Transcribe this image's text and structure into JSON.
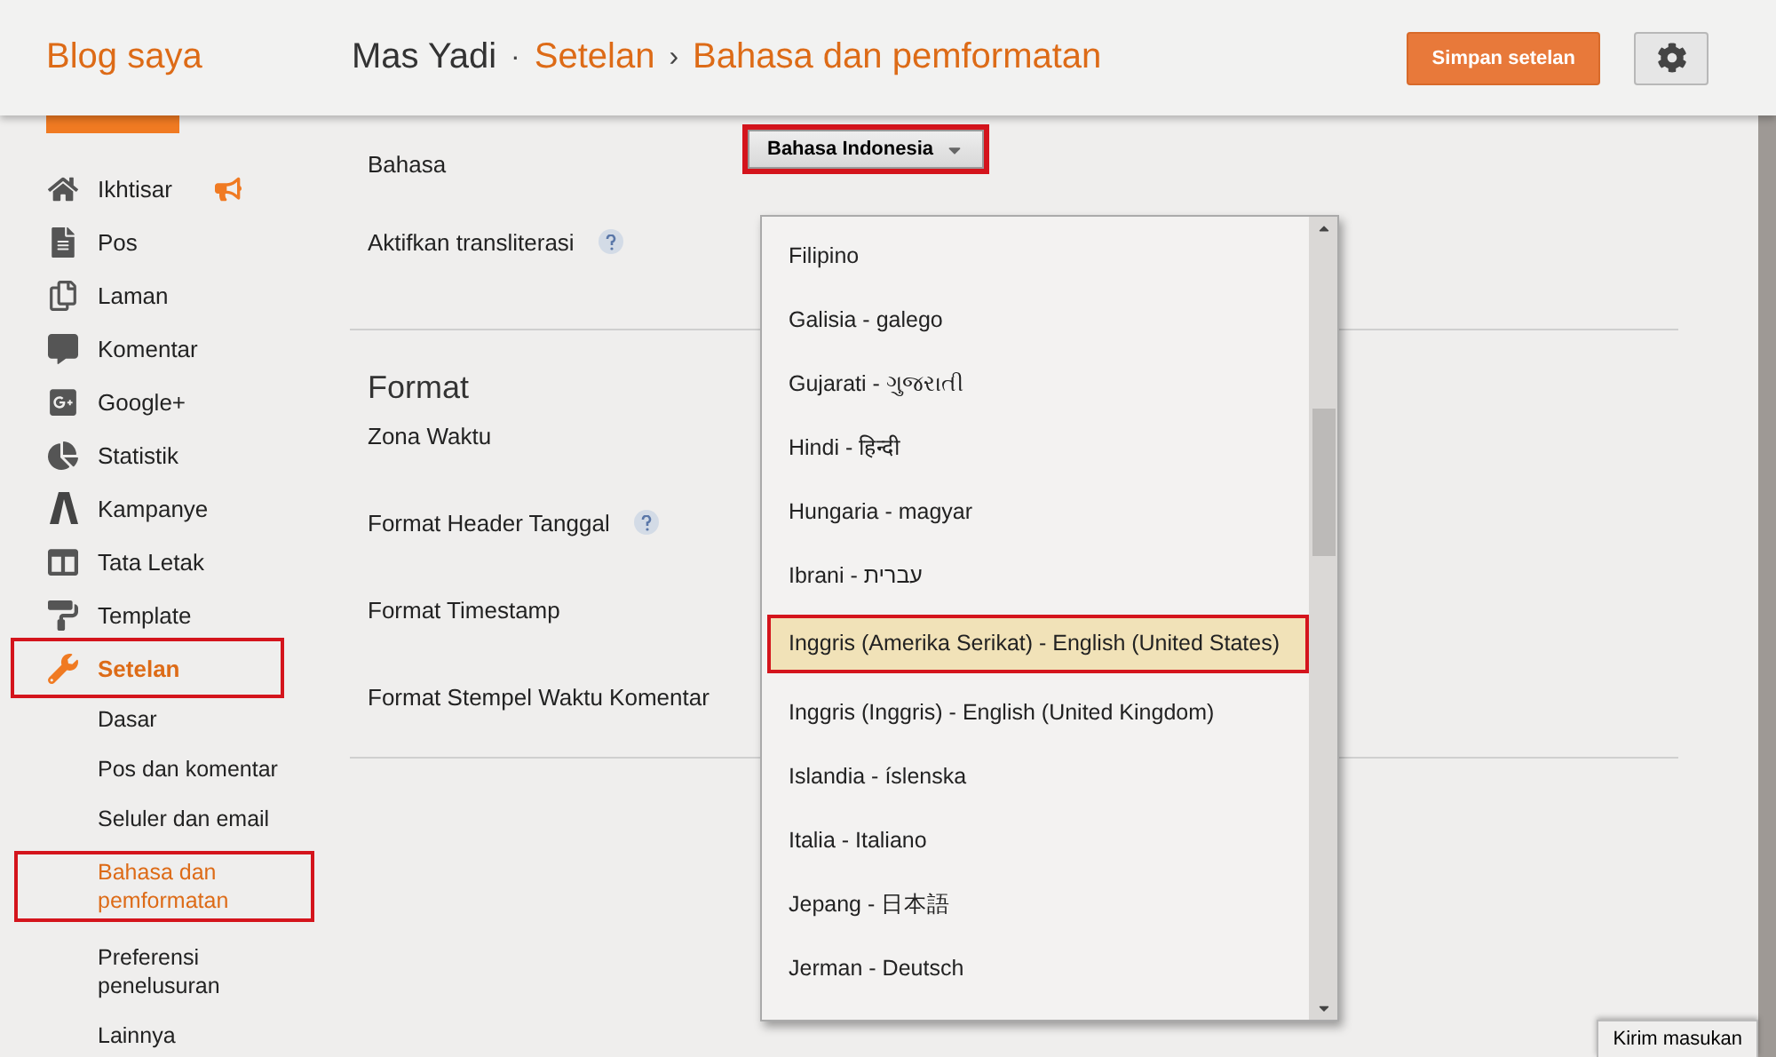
{
  "header": {
    "brand": "Blog saya",
    "breadcrumb": [
      {
        "label": "Mas Yadi",
        "kind": "blog",
        "separator": "·"
      },
      {
        "label": "Setelan",
        "kind": "link",
        "separator": "›"
      },
      {
        "label": "Bahasa dan pemformatan",
        "kind": "link"
      }
    ],
    "save_button": "Simpan setelan"
  },
  "sidebar": {
    "items": [
      {
        "label": "Ikhtisar",
        "selected": false,
        "badge": true
      },
      {
        "label": "Pos",
        "selected": false
      },
      {
        "label": "Laman",
        "selected": false
      },
      {
        "label": "Komentar",
        "selected": false
      },
      {
        "label": "Google+",
        "selected": false
      },
      {
        "label": "Statistik",
        "selected": false
      },
      {
        "label": "Kampanye",
        "selected": false
      },
      {
        "label": "Tata Letak",
        "selected": false
      },
      {
        "label": "Template",
        "selected": false
      },
      {
        "label": "Setelan",
        "selected": true,
        "outlined": true,
        "children": [
          {
            "label": "Dasar",
            "selected": false,
            "outlined": false
          },
          {
            "label": "Pos dan komentar",
            "selected": false,
            "outlined": false
          },
          {
            "label": "Seluler dan email",
            "selected": false,
            "outlined": false
          },
          {
            "label": "Bahasa dan pemformatan",
            "selected": true,
            "outlined": true
          },
          {
            "label": "Preferensi penelusuran",
            "selected": false,
            "outlined": false
          },
          {
            "label": "Lainnya",
            "selected": false,
            "outlined": false
          }
        ]
      }
    ]
  },
  "language_section": {
    "rows": [
      {
        "label": "Bahasa",
        "kind": "select",
        "value": "Bahasa Indonesia",
        "outlined": true
      },
      {
        "label": "Aktifkan transliterasi",
        "kind": "help"
      }
    ]
  },
  "format_section": {
    "title": "Format",
    "rows": [
      {
        "label": "Zona Waktu",
        "kind": "plain"
      },
      {
        "label": "Format Header Tanggal",
        "kind": "help"
      },
      {
        "label": "Format Timestamp",
        "kind": "plain"
      },
      {
        "label": "Format Stempel Waktu Komentar",
        "kind": "plain"
      }
    ]
  },
  "language_dropdown": {
    "options": [
      {
        "label": "Filipino",
        "selected": false
      },
      {
        "label": "Galisia - galego",
        "selected": false
      },
      {
        "label": "Gujarati - ગુજરાતી",
        "selected": false
      },
      {
        "label": "Hindi - हिन्दी",
        "selected": false
      },
      {
        "label": "Hungaria - magyar",
        "selected": false
      },
      {
        "label": "Ibrani - עברית",
        "selected": false
      },
      {
        "label": "Inggris (Amerika Serikat) - English (United States)",
        "selected": true,
        "outlined": true
      },
      {
        "label": "Inggris (Inggris) - English (United Kingdom)",
        "selected": false
      },
      {
        "label": "Islandia - íslenska",
        "selected": false
      },
      {
        "label": "Italia - Italiano",
        "selected": false
      },
      {
        "label": "Jepang - 日本語",
        "selected": false
      },
      {
        "label": "Jerman - Deutsch",
        "selected": false
      }
    ]
  },
  "feedback_button": "Kirim masukan"
}
